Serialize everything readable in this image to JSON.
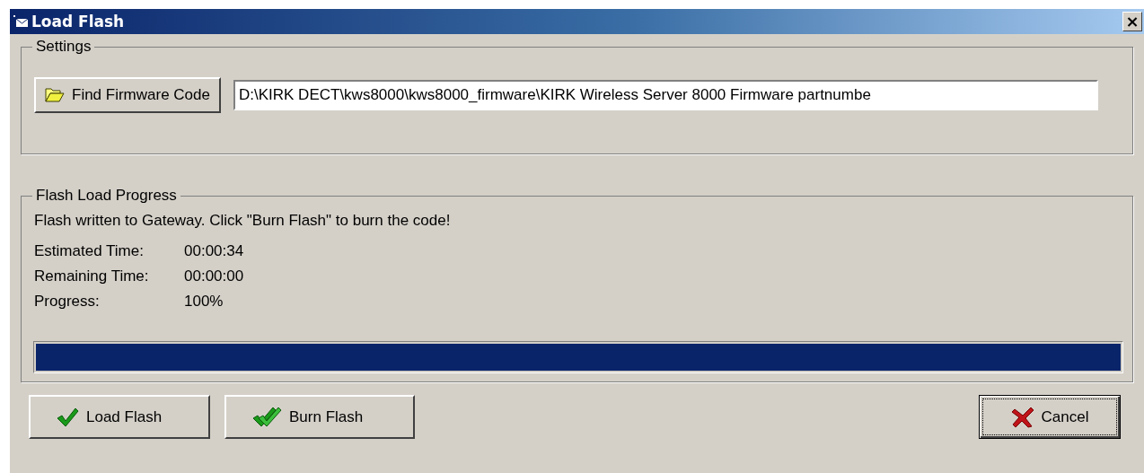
{
  "window": {
    "title": "Load Flash",
    "close": "×"
  },
  "settings": {
    "title": "Settings",
    "find_button": "Find Firmware Code",
    "path": "D:\\KIRK DECT\\kws8000\\kws8000_firmware\\KIRK Wireless Server 8000 Firmware partnumbe"
  },
  "progress_group": {
    "title": "Flash Load Progress",
    "message": "Flash written to Gateway. Click \"Burn Flash\" to burn the code!",
    "rows": [
      {
        "label": "Estimated Time:",
        "value": "00:00:34"
      },
      {
        "label": "Remaining Time:",
        "value": "00:00:00"
      },
      {
        "label": "Progress:",
        "value": "100%"
      }
    ],
    "level": 1
  },
  "buttons": [
    {
      "label": "Load Flash",
      "kind": "check",
      "focused": false
    },
    {
      "label": "Burn Flash",
      "kind": "double-check",
      "focused": false
    },
    {
      "label": "Cancel",
      "kind": "cross",
      "focused": true
    }
  ]
}
